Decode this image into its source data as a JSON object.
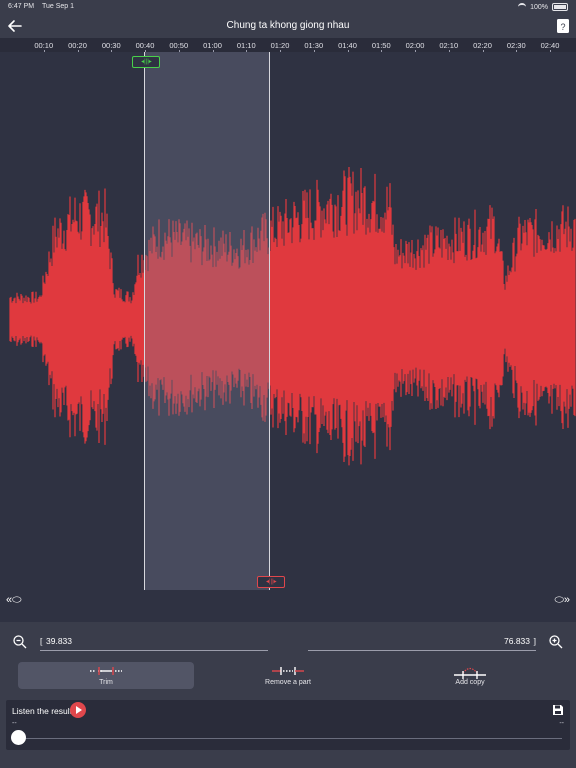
{
  "status_bar": {
    "time": "6:47 PM",
    "date": "Tue Sep 1",
    "battery": "100%"
  },
  "header": {
    "title": "Chung ta khong giong nhau"
  },
  "timeline": {
    "labels": [
      "00:10",
      "00:20",
      "00:30",
      "00:40",
      "00:50",
      "01:00",
      "01:10",
      "01:20",
      "01:30",
      "01:40",
      "01:50",
      "02:00",
      "02:10",
      "02:20",
      "02:30",
      "02:40"
    ]
  },
  "waveform": {
    "color": "#e0393e",
    "selection_start_sec": 39.833,
    "selection_end_sec": 76.833
  },
  "range": {
    "start": "39.833",
    "end": "76.833"
  },
  "tools": [
    {
      "label": "Trim",
      "icon": "trim-icon",
      "active": true
    },
    {
      "label": "Remove a part",
      "icon": "remove-part-icon",
      "active": false
    },
    {
      "label": "Add copy",
      "icon": "add-copy-icon",
      "active": false
    }
  ],
  "player": {
    "label": "Listen the result",
    "position_left": "--",
    "position_right": "--",
    "progress": 0
  },
  "colors": {
    "accent": "#e0474c",
    "start_handle": "#48d04a",
    "background": "#2f3242",
    "panel": "#3a3d4b"
  }
}
